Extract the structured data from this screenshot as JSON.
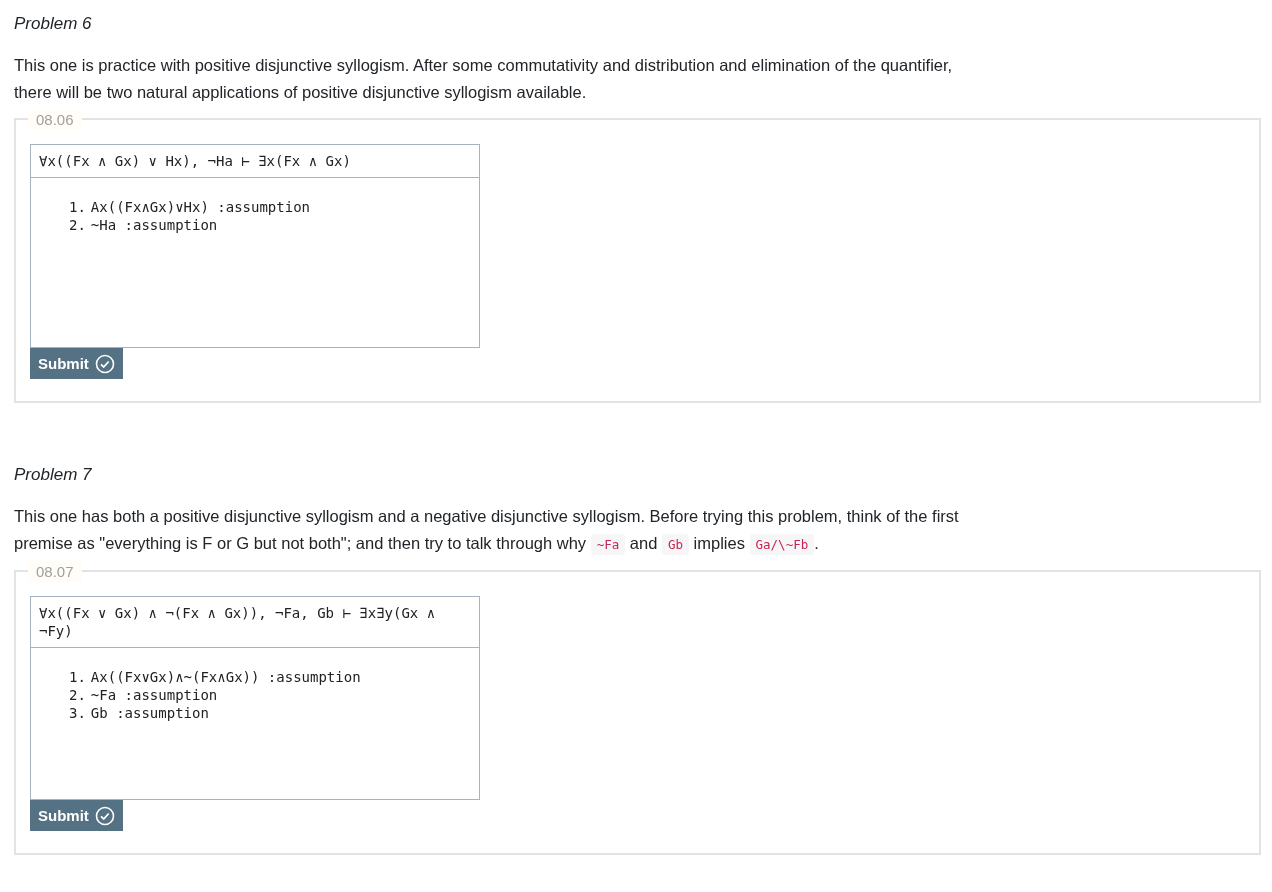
{
  "problems": [
    {
      "title": "Problem 6",
      "description": [
        {
          "kind": "text",
          "text": "This one is practice with positive disjunctive syllogism. After some commutativity and distribution and elimination of the quantifier, there will be two natural applications of positive disjunctive syllogism available."
        }
      ],
      "exercise": {
        "number": "08.06",
        "sequent": "∀x((Fx ∧ Gx) ∨ Hx), ¬Ha ⊢ ∃x(Fx ∧ Gx)",
        "lines": [
          {
            "number": "1.",
            "formula": "Ax((Fx∧Gx)∨Hx)",
            "justification": ":assumption"
          },
          {
            "number": "2.",
            "formula": "~Ha",
            "justification": ":assumption"
          }
        ],
        "button": "Submit"
      }
    },
    {
      "title": "Problem 7",
      "description": [
        {
          "kind": "text",
          "text": "This one has both a positive disjunctive syllogism and a negative disjunctive syllogism. Before trying this problem, think of the first premise as \"everything is F or G but not both\"; and then try to talk through why "
        },
        {
          "kind": "code",
          "text": "~Fa"
        },
        {
          "kind": "text",
          "text": " and "
        },
        {
          "kind": "code",
          "text": "Gb"
        },
        {
          "kind": "text",
          "text": " implies "
        },
        {
          "kind": "code",
          "text": "Ga/\\~Fb"
        },
        {
          "kind": "text",
          "text": "."
        }
      ],
      "exercise": {
        "number": "08.07",
        "sequent": "∀x((Fx ∨ Gx) ∧ ¬(Fx ∧ Gx)), ¬Fa, Gb ⊢ ∃x∃y(Gx ∧ ¬Fy)",
        "lines": [
          {
            "number": "1.",
            "formula": "Ax((Fx∨Gx)∧~(Fx∧Gx))",
            "justification": ":assumption"
          },
          {
            "number": "2.",
            "formula": "~Fa",
            "justification": ":assumption"
          },
          {
            "number": "3.",
            "formula": "Gb",
            "justification": ":assumption"
          }
        ],
        "button": "Submit"
      }
    }
  ]
}
